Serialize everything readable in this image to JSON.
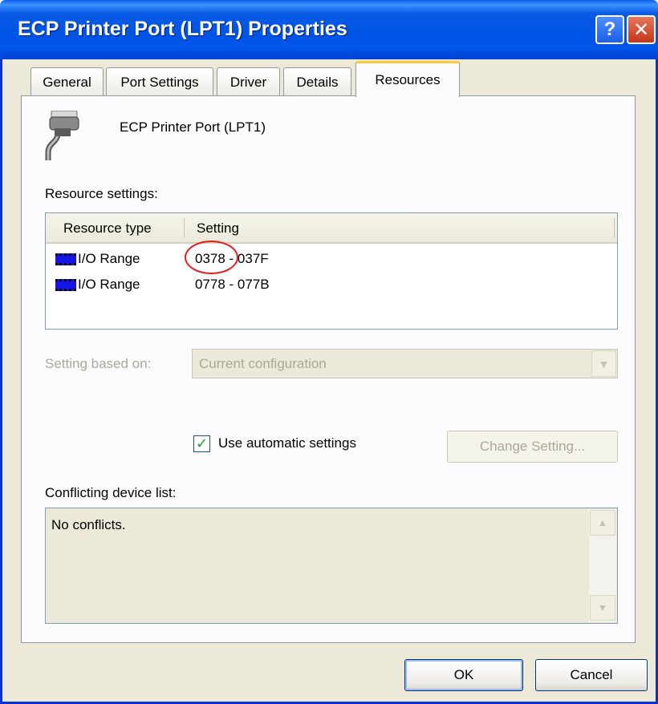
{
  "window": {
    "title": "ECP Printer Port (LPT1) Properties",
    "help_glyph": "?",
    "close_glyph": "✕"
  },
  "tabs": [
    {
      "label": "General",
      "active": false
    },
    {
      "label": "Port Settings",
      "active": false
    },
    {
      "label": "Driver",
      "active": false
    },
    {
      "label": "Details",
      "active": false
    },
    {
      "label": "Resources",
      "active": true
    }
  ],
  "device": {
    "name": "ECP Printer Port (LPT1)",
    "icon": "serial-cable-icon"
  },
  "resource_settings": {
    "label": "Resource settings:",
    "columns": [
      "Resource type",
      "Setting"
    ],
    "rows": [
      {
        "type": "I/O Range",
        "setting": "0378 - 037F",
        "icon": "chip-icon"
      },
      {
        "type": "I/O Range",
        "setting": "0778 - 077B",
        "icon": "chip-icon"
      }
    ],
    "annotation_color": "#e31b1b"
  },
  "setting_based_on": {
    "label": "Setting based on:",
    "value": "Current configuration"
  },
  "automatic": {
    "label": "Use automatic settings",
    "checked": true
  },
  "change_setting_label": "Change Setting...",
  "conflicts": {
    "label": "Conflicting device list:",
    "text": "No conflicts."
  },
  "buttons": {
    "ok": "OK",
    "cancel": "Cancel"
  },
  "colors": {
    "titlebar": "#0054e3",
    "window_bg": "#ece9d8",
    "active_tab_accent": "#ffc83c"
  }
}
